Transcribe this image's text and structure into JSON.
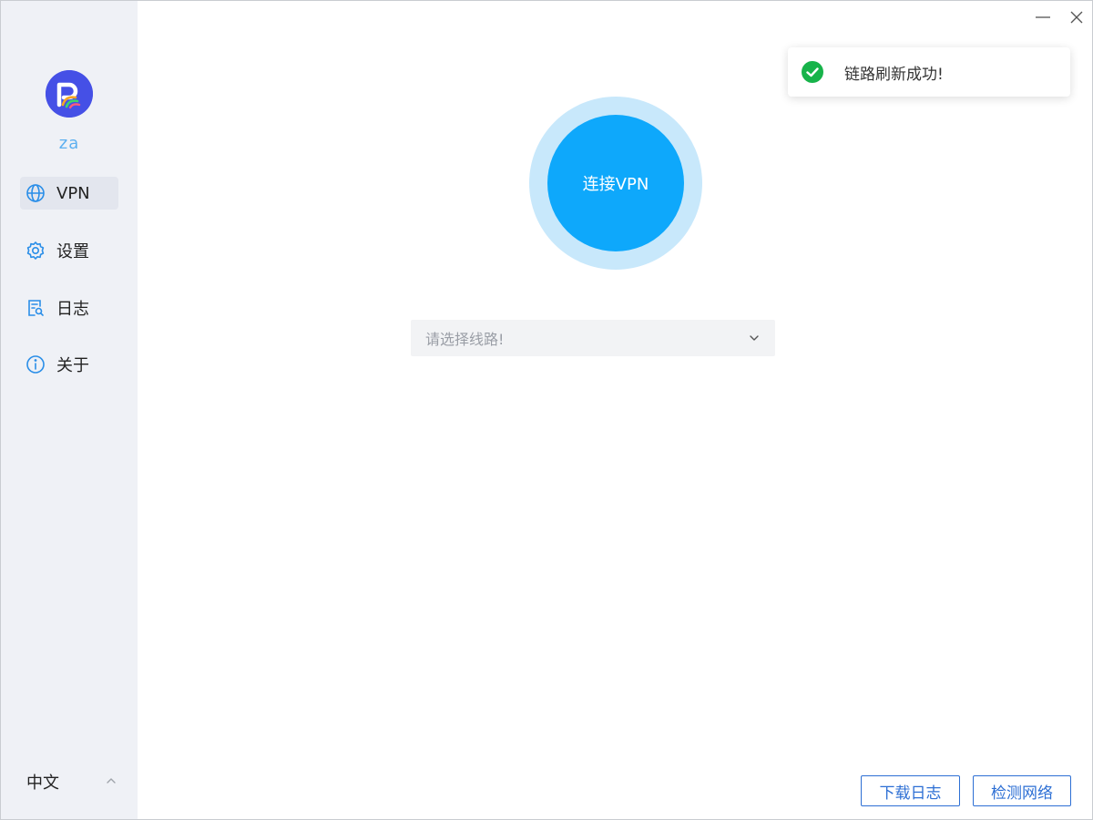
{
  "sidebar": {
    "username": "za",
    "items": [
      {
        "label": "VPN",
        "icon": "globe-icon",
        "active": true
      },
      {
        "label": "设置",
        "icon": "gear-icon",
        "active": false
      },
      {
        "label": "日志",
        "icon": "log-search-icon",
        "active": false
      },
      {
        "label": "关于",
        "icon": "info-icon",
        "active": false
      }
    ],
    "language": "中文"
  },
  "main": {
    "connect_label": "连接VPN",
    "route_placeholder": "请选择线路!"
  },
  "toast": {
    "message": "链路刷新成功!",
    "icon": "check-circle-icon"
  },
  "footer": {
    "download_log_label": "下载日志",
    "check_network_label": "检测网络"
  },
  "colors": {
    "accent": "#0ea8fb",
    "accent_halo": "#c8e8fb",
    "sidebar_bg": "#eff1f6",
    "link_blue": "#2d6fd4",
    "success": "#17b34a",
    "avatar_bg": "#4550e6"
  }
}
